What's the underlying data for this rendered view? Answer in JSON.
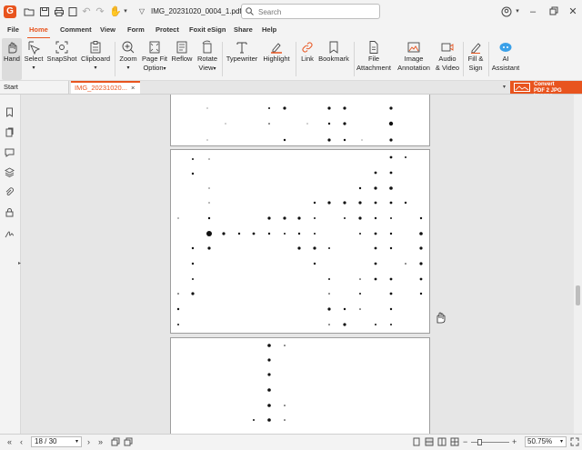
{
  "app": {
    "title": "IMG_20231020_0004_1.pdf -...",
    "accent": "#e8541e"
  },
  "search": {
    "placeholder": "Search"
  },
  "menu": {
    "file": "File",
    "home": "Home",
    "comment": "Comment",
    "view": "View",
    "form": "Form",
    "protect": "Protect",
    "esign": "Foxit eSign",
    "share": "Share",
    "help": "Help"
  },
  "ribbon": {
    "hand": "Hand",
    "select": "Select",
    "snapshot": "SnapShot",
    "clipboard": "Clipboard",
    "zoom": "Zoom",
    "page_fit_1": "Page Fit",
    "page_fit_2": "Option",
    "reflow": "Reflow",
    "rotate_1": "Rotate",
    "rotate_2": "View",
    "typewriter": "Typewriter",
    "highlight": "Highlight",
    "link": "Link",
    "bookmark": "Bookmark",
    "file_att_1": "File",
    "file_att_2": "Attachment",
    "image_ann_1": "Image",
    "image_ann_2": "Annotation",
    "audio_1": "Audio",
    "audio_2": "& Video",
    "fill_1": "Fill &",
    "fill_2": "Sign",
    "ai_1": "AI",
    "ai_2": "Assistant"
  },
  "tabs": {
    "start": "Start",
    "document": "IMG_20231020...",
    "close": "×"
  },
  "convert": {
    "line1": "Convert",
    "line2": "PDF 2 JPG Images"
  },
  "status": {
    "page": "18 / 30",
    "zoom": "50.75%"
  }
}
